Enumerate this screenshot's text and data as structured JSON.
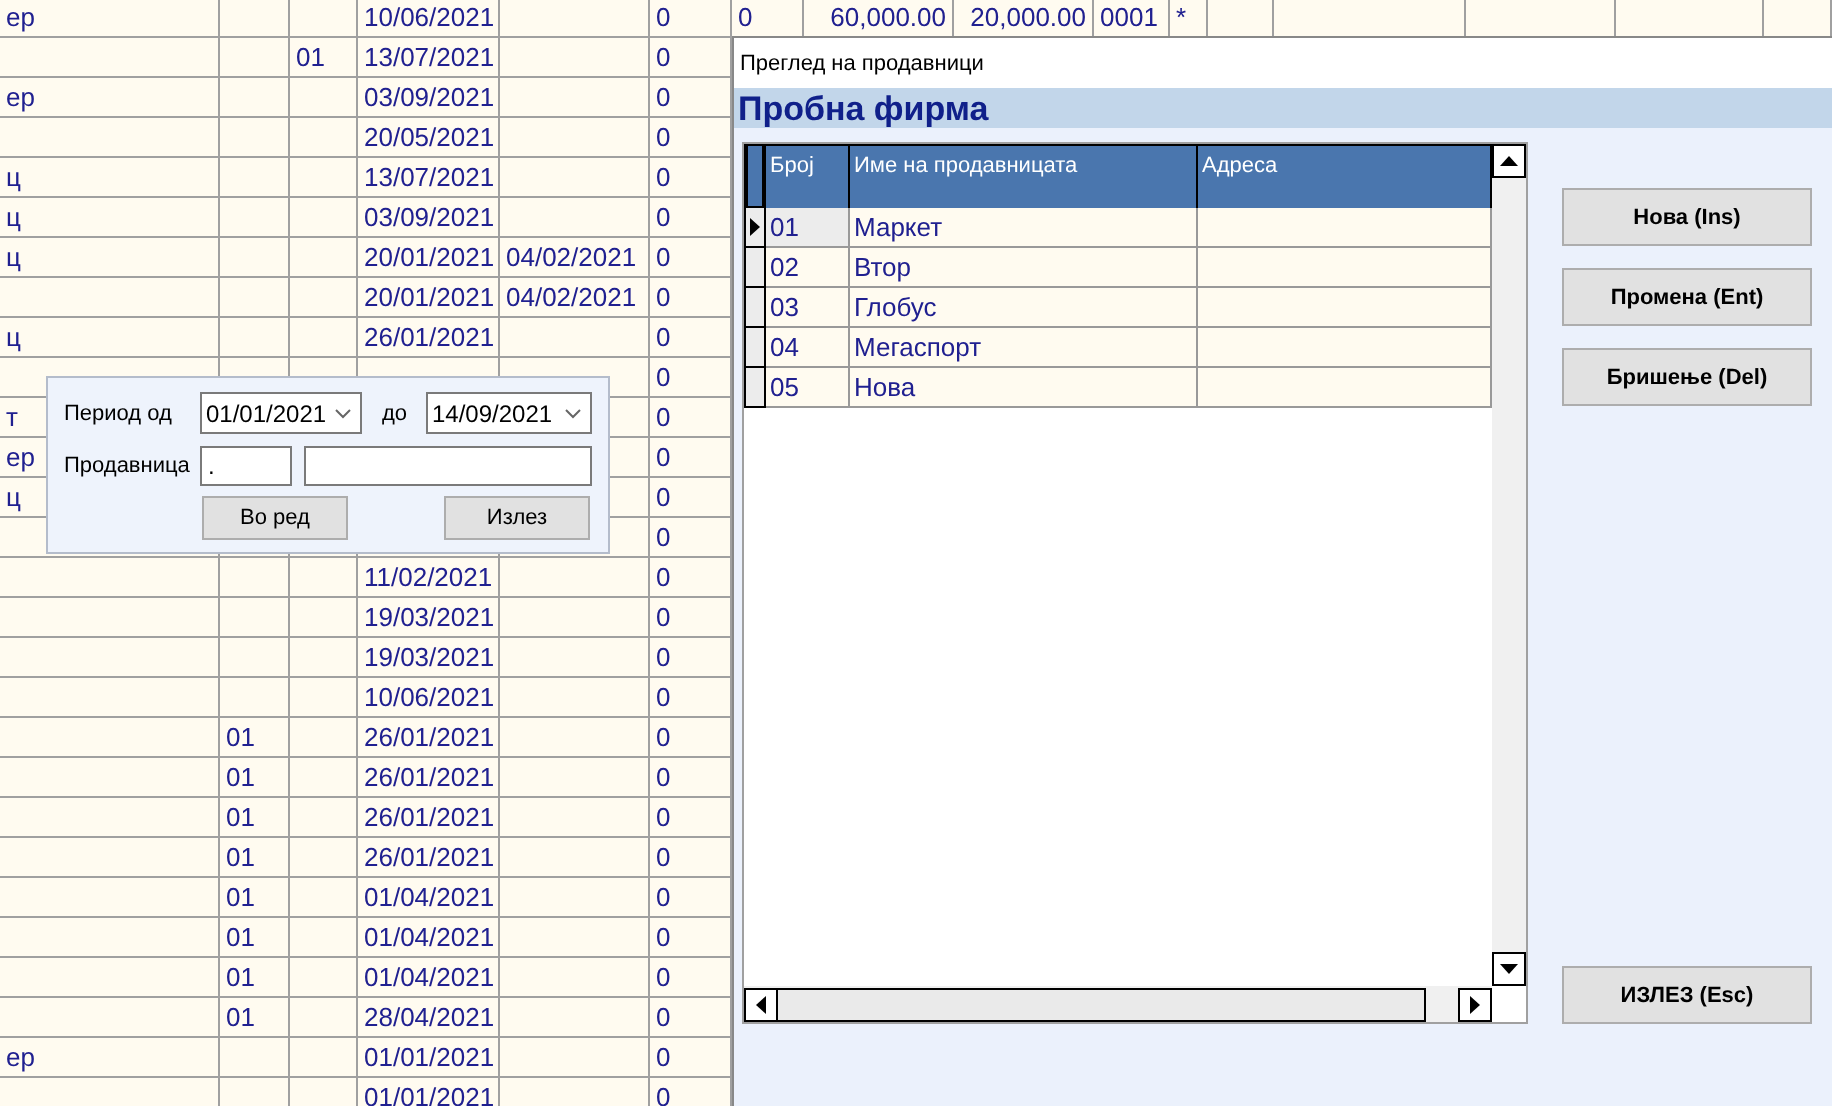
{
  "grid": {
    "rows": [
      {
        "column_1": "ер",
        "column_4": "10/06/2021",
        "column_6": "0",
        "column_7": "0",
        "column_8": "60,000.00",
        "column_9": "20,000.00",
        "column_10": "0001",
        "column_11": "*"
      },
      {
        "column_3": "01",
        "column_4": "13/07/2021",
        "column_6": "0"
      },
      {
        "column_1": "ер",
        "column_4": "03/09/2021",
        "column_6": "0"
      },
      {
        "column_4": "20/05/2021",
        "column_6": "0"
      },
      {
        "column_1": "ц",
        "column_4": "13/07/2021",
        "column_6": "0"
      },
      {
        "column_1": "ц",
        "column_4": "03/09/2021",
        "column_6": "0"
      },
      {
        "column_1": "ц",
        "column_4": "20/01/2021",
        "column_5": "04/02/2021",
        "column_6": "0"
      },
      {
        "column_4": "20/01/2021",
        "column_5": "04/02/2021",
        "column_6": "0"
      },
      {
        "column_1": "ц",
        "column_4": "26/01/2021",
        "column_6": "0"
      },
      {
        "column_6": "0"
      },
      {
        "column_1": "т",
        "column_6": "0"
      },
      {
        "column_1": "ер",
        "column_6": "0"
      },
      {
        "column_1": "ц",
        "column_6": "0"
      },
      {
        "column_6": "0"
      },
      {
        "column_4": "11/02/2021",
        "column_6": "0"
      },
      {
        "column_4": "19/03/2021",
        "column_6": "0"
      },
      {
        "column_4": "19/03/2021",
        "column_6": "0"
      },
      {
        "column_4": "10/06/2021",
        "column_6": "0"
      },
      {
        "column_2": "01",
        "column_4": "26/01/2021",
        "column_6": "0"
      },
      {
        "column_2": "01",
        "column_4": "26/01/2021",
        "column_6": "0"
      },
      {
        "column_2": "01",
        "column_4": "26/01/2021",
        "column_6": "0"
      },
      {
        "column_2": "01",
        "column_4": "26/01/2021",
        "column_6": "0"
      },
      {
        "column_2": "01",
        "column_4": "01/04/2021",
        "column_6": "0"
      },
      {
        "column_2": "01",
        "column_4": "01/04/2021",
        "column_6": "0"
      },
      {
        "column_2": "01",
        "column_4": "01/04/2021",
        "column_6": "0"
      },
      {
        "column_2": "01",
        "column_4": "28/04/2021",
        "column_6": "0"
      },
      {
        "column_1": "ер",
        "column_4": "01/01/2021",
        "column_6": "0"
      },
      {
        "column_4": "01/01/2021",
        "column_6": "0"
      }
    ]
  },
  "filter": {
    "period_label": "Период од",
    "date_from": "01/01/2021",
    "to_label": "до",
    "date_to": "14/09/2021",
    "store_label": "Продавница",
    "store_code": ".",
    "buttons": [
      "Во ред",
      "Излез"
    ]
  },
  "window": {
    "title": "Преглед на продавници",
    "company": "Пробна фирма",
    "table": {
      "columns": [
        "Број",
        "Име на продавницата",
        "Адреса"
      ],
      "rows": [
        {
          "number": "01",
          "name": "Маркет",
          "selected": true
        },
        {
          "number": "02",
          "name": "Втор",
          "selected": false
        },
        {
          "number": "03",
          "name": "Глобус",
          "selected": false
        },
        {
          "number": "04",
          "name": "Мегаспорт",
          "selected": false
        },
        {
          "number": "05",
          "name": "Нова",
          "selected": false
        }
      ]
    },
    "buttons": [
      "Нова (Ins)",
      "Промена (Ent)",
      "Бришење (Del)"
    ],
    "exit_button": "ИЗЛЕЗ (Esc)"
  }
}
